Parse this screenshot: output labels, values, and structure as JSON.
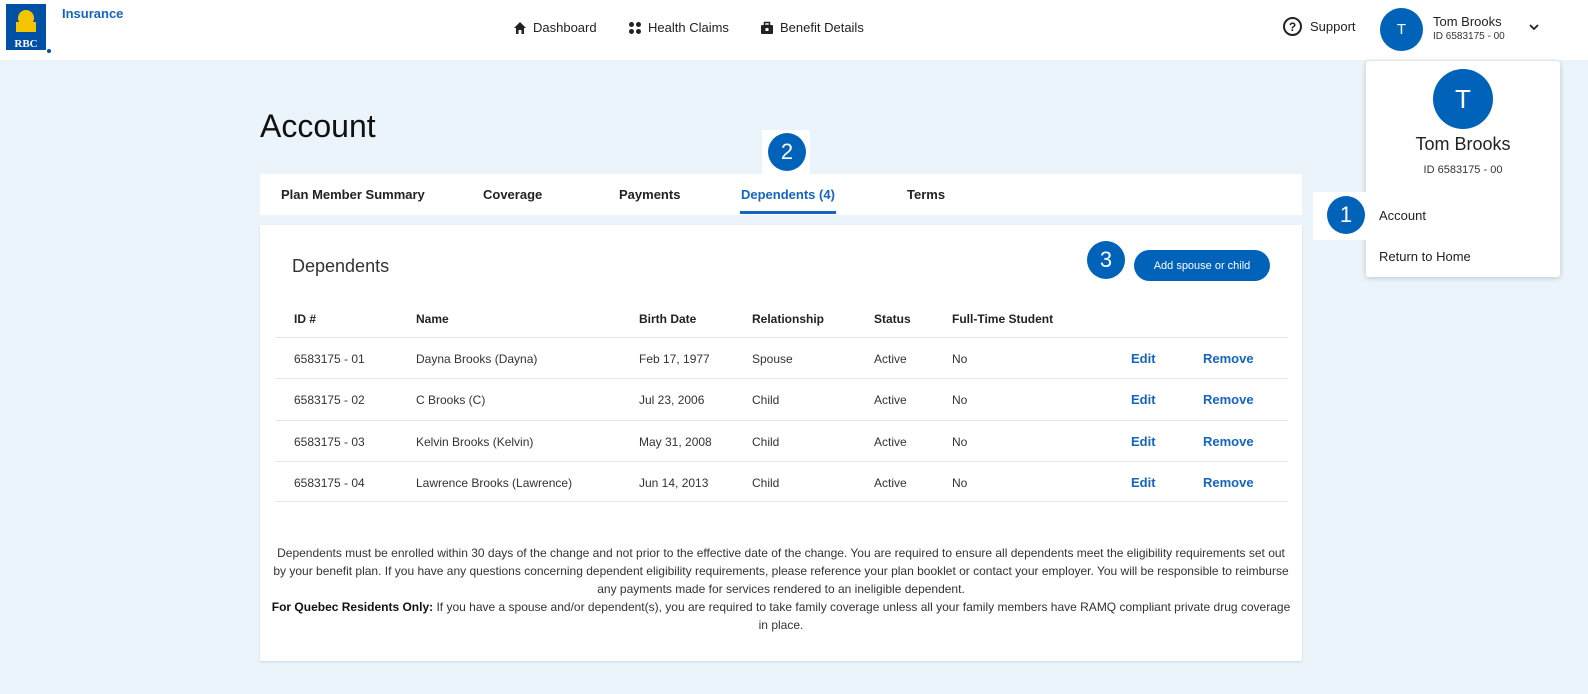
{
  "header": {
    "brand_word": "Insurance",
    "logo_text": "RBC",
    "nav": [
      {
        "label": "Dashboard",
        "icon": "home-icon"
      },
      {
        "label": "Health Claims",
        "icon": "dots-grid-icon"
      },
      {
        "label": "Benefit Details",
        "icon": "briefcase-icon"
      }
    ],
    "support_label": "Support",
    "user": {
      "initial": "T",
      "name": "Tom Brooks",
      "id": "ID 6583175 - 00"
    }
  },
  "dropdown": {
    "initial": "T",
    "name": "Tom Brooks",
    "id": "ID 6583175 - 00",
    "items": [
      "Account",
      "Return to Home"
    ]
  },
  "callouts": [
    "1",
    "2",
    "3"
  ],
  "page": {
    "title": "Account"
  },
  "tabs": [
    "Plan Member Summary",
    "Coverage",
    "Payments",
    "Dependents (4)",
    "Terms"
  ],
  "dependents": {
    "title": "Dependents",
    "add_button": "Add spouse or child",
    "columns": [
      "ID #",
      "Name",
      "Birth Date",
      "Relationship",
      "Status",
      "Full-Time Student"
    ],
    "rows": [
      {
        "id": "6583175 - 01",
        "name": "Dayna Brooks (Dayna)",
        "birth": "Feb 17, 1977",
        "relationship": "Spouse",
        "status": "Active",
        "student": "No",
        "edit": "Edit",
        "remove": "Remove"
      },
      {
        "id": "6583175 - 02",
        "name": "C Brooks (C)",
        "birth": "Jul 23, 2006",
        "relationship": "Child",
        "status": "Active",
        "student": "No",
        "edit": "Edit",
        "remove": "Remove"
      },
      {
        "id": "6583175 - 03",
        "name": "Kelvin Brooks (Kelvin)",
        "birth": "May 31, 2008",
        "relationship": "Child",
        "status": "Active",
        "student": "No",
        "edit": "Edit",
        "remove": "Remove"
      },
      {
        "id": "6583175 - 04",
        "name": "Lawrence Brooks (Lawrence)",
        "birth": "Jun 14, 2013",
        "relationship": "Child",
        "status": "Active",
        "student": "No",
        "edit": "Edit",
        "remove": "Remove"
      }
    ],
    "notice_p1": "Dependents must be enrolled within 30 days of the change and not prior to the effective date of the change. You are required to ensure all dependents meet the eligibility requirements set out by your benefit plan. If you have any questions concerning dependent eligibility requirements, please reference your plan booklet or contact your employer. You will be responsible to reimburse any payments made for services rendered to an ineligible dependent.",
    "notice_bold": "For Quebec Residents Only:",
    "notice_p2": "If you have a spouse and/or dependent(s), you are required to take family coverage unless all your family members have RAMQ compliant private drug coverage in place."
  },
  "colors": {
    "accent": "#0062b9",
    "link": "#1565c0",
    "background": "#eaf4fa"
  }
}
